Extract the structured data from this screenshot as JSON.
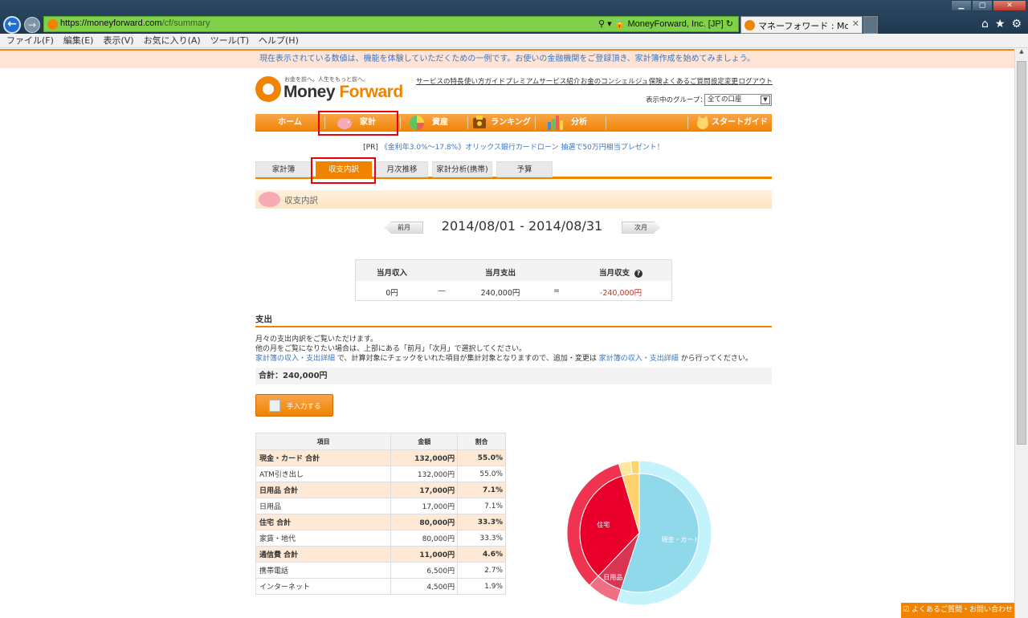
{
  "browser": {
    "url_host": "https://moneyforward.com",
    "url_path": "/cf/summary",
    "site_cert": "MoneyForward, Inc. [JP]",
    "tab_title": "マネーフォワード : Mone...",
    "menu": [
      "ファイル(F)",
      "編集(E)",
      "表示(V)",
      "お気に入り(A)",
      "ツール(T)",
      "ヘルプ(H)"
    ]
  },
  "notice": "現在表示されている数値は、機能を体験していただくための一例です。お使いの金融機関をご登録頂き、家計簿作成を始めてみましょう。",
  "logo": {
    "tagline": "お金を前へ。人生をもっと前へ。",
    "text_a": "Money ",
    "text_b": "Forward"
  },
  "toplinks": [
    "サービスの特長",
    "使い方ガイド",
    "プレミアムサービス紹介",
    "お金のコンシェルジュ",
    "保険",
    "よくあるご質問",
    "設定変更",
    "ログアウト"
  ],
  "group": {
    "label": "表示中のグループ：",
    "value": "全ての口座"
  },
  "gnav": {
    "home": "ホーム",
    "kakei": "家計",
    "shisan": "資産",
    "ranking": "ランキング",
    "bunseki": "分析",
    "guide": "スタートガイド"
  },
  "pr": {
    "prefix": "[PR]",
    "link": "《金利年3.0%～17.8%》オリックス銀行カードローン 抽選で50万円相当プレゼント！"
  },
  "subtabs": [
    "家計簿",
    "収支内訳",
    "月次推移",
    "家計分析(携帯)",
    "予算"
  ],
  "section_title": "収支内訳",
  "period": {
    "prev": "前月",
    "range": "2014/08/01 - 2014/08/31",
    "next": "次月"
  },
  "summary": {
    "income_label": "当月収入",
    "expense_label": "当月支出",
    "balance_label": "当月収支",
    "income": "0円",
    "minus": "—",
    "expense": "240,000円",
    "equals": "=",
    "balance": "-240,000円"
  },
  "expense_heading": "支出",
  "desc": {
    "line1": "月々の支出内訳をご覧いただけます。",
    "line2": "他の月をご覧になりたい場合は、上部にある「前月」「次月」で選択してください。",
    "link1": "家計簿の収入・支出詳細",
    "mid": " で、計算対象にチェックをいれた項目が集計対象となりますので、追加・変更は ",
    "link2": "家計簿の収入・支出詳細",
    "tail": " から行ってください。"
  },
  "total": "合計：240,000円",
  "manual_button": "手入力する",
  "table": {
    "headers": [
      "項目",
      "金額",
      "割合"
    ],
    "rows": [
      {
        "name": "現金・カード 合計",
        "amount": "132,000円",
        "ratio": "55.0%",
        "category": true
      },
      {
        "name": "ATM引き出し",
        "amount": "132,000円",
        "ratio": "55.0%",
        "category": false
      },
      {
        "name": "日用品 合計",
        "amount": "17,000円",
        "ratio": "7.1%",
        "category": true
      },
      {
        "name": "日用品",
        "amount": "17,000円",
        "ratio": "7.1%",
        "category": false
      },
      {
        "name": "住宅 合計",
        "amount": "80,000円",
        "ratio": "33.3%",
        "category": true
      },
      {
        "name": "家賃・地代",
        "amount": "80,000円",
        "ratio": "33.3%",
        "category": false
      },
      {
        "name": "通信費 合計",
        "amount": "11,000円",
        "ratio": "4.6%",
        "category": true
      },
      {
        "name": "携帯電話",
        "amount": "6,500円",
        "ratio": "2.7%",
        "category": false
      },
      {
        "name": "インターネット",
        "amount": "4,500円",
        "ratio": "1.9%",
        "category": false
      }
    ]
  },
  "chart_data": {
    "type": "pie",
    "inner": [
      {
        "label": "現金・カード",
        "value": 55.0,
        "color": "#8fd9ea"
      },
      {
        "label": "日用品",
        "value": 7.1,
        "color": "#d73552"
      },
      {
        "label": "住宅",
        "value": 33.3,
        "color": "#e8002a"
      },
      {
        "label": "",
        "value": 4.6,
        "color": "#ffd36b"
      }
    ],
    "outer": [
      {
        "value": 55.0,
        "color": "#c5f3fb"
      },
      {
        "value": 7.1,
        "color": "#f06d82"
      },
      {
        "value": 33.3,
        "color": "#f0344f"
      },
      {
        "value": 2.7,
        "color": "#ffe79c"
      },
      {
        "value": 1.9,
        "color": "#ffd36b"
      }
    ]
  },
  "footer_help": "よくあるご質問・お問い合わせ"
}
